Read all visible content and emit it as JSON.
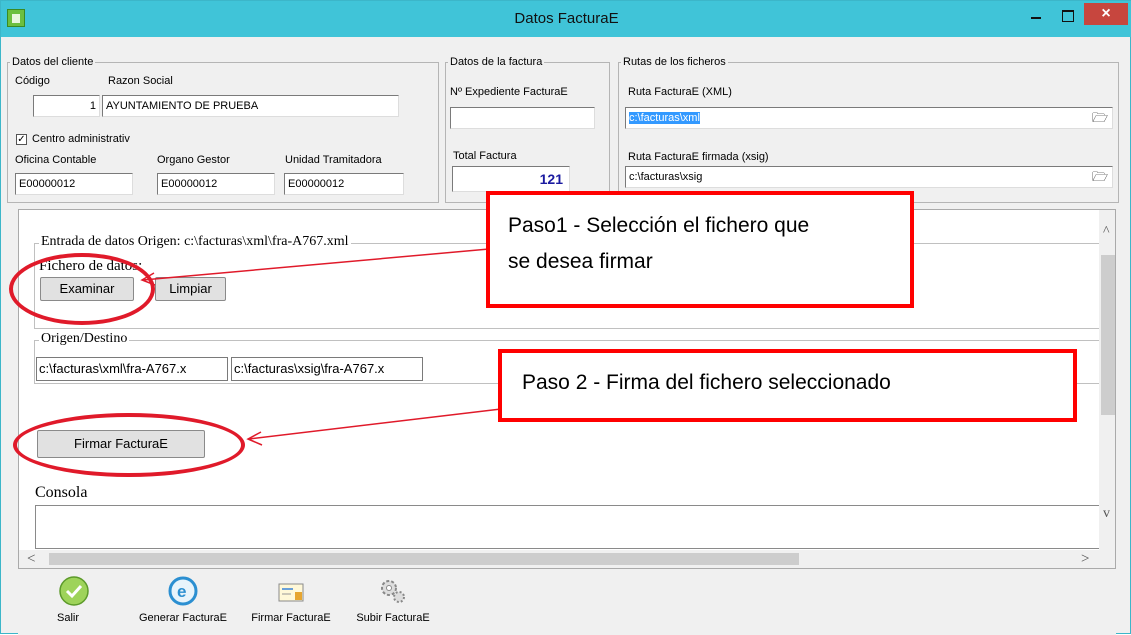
{
  "window": {
    "title": "Datos FacturaE",
    "close_glyph": "×"
  },
  "cliente": {
    "legend": "Datos del cliente",
    "codigo_label": "Código",
    "razon_label": "Razon Social",
    "codigo_value": "1",
    "razon_value": "AYUNTAMIENTO DE PRUEBA",
    "centro_label": "Centro administrativ",
    "centro_checked": "✓",
    "oficina_label": "Oficina Contable",
    "organo_label": "Organo Gestor",
    "unidad_label": "Unidad Tramitadora",
    "oficina_value": "E00000012",
    "organo_value": "E00000012",
    "unidad_value": "E00000012"
  },
  "factura": {
    "legend": "Datos de la factura",
    "expediente_label": "Nº Expediente FacturaE",
    "expediente_value": "",
    "total_label": "Total Factura",
    "total_value": "121"
  },
  "rutas": {
    "legend": "Rutas de los ficheros",
    "xml_label": "Ruta FacturaE (XML)",
    "xml_value": "c:\\facturas\\xml",
    "xsig_label": "Ruta FacturaE firmada (xsig)",
    "xsig_value": "c:\\facturas\\xsig",
    "browse_glyph": "🗁"
  },
  "panel": {
    "entrada_legend": "Entrada de datos Origen: c:\\facturas\\xml\\fra-A767.xml",
    "fichero_label": "Fichero de datos:",
    "examinar": "Examinar",
    "limpiar": "Limpiar",
    "origen_legend": "Origen/Destino",
    "origen_value": "c:\\facturas\\xml\\fra-A767.x",
    "destino_value": "c:\\facturas\\xsig\\fra-A767.x",
    "firmar": "Firmar FacturaE",
    "consola": "Consola"
  },
  "callouts": {
    "paso1_line1": "Paso1 - Selección el fichero que",
    "paso1_line2": "se desea firmar",
    "paso2": "Paso 2 - Firma del fichero seleccionado"
  },
  "toolbar": {
    "items": [
      {
        "label": "Salir",
        "icon": "check-icon"
      },
      {
        "label": "Generar FacturaE",
        "icon": "refresh-e-icon"
      },
      {
        "label": "Firmar FacturaE",
        "icon": "sign-document-icon"
      },
      {
        "label": "Subir FacturaE",
        "icon": "gears-icon"
      }
    ]
  },
  "colors": {
    "titlebar": "#40c4d8",
    "callout_border": "#ff0000",
    "selection": "#3399ff",
    "total": "#1a1aa0"
  }
}
